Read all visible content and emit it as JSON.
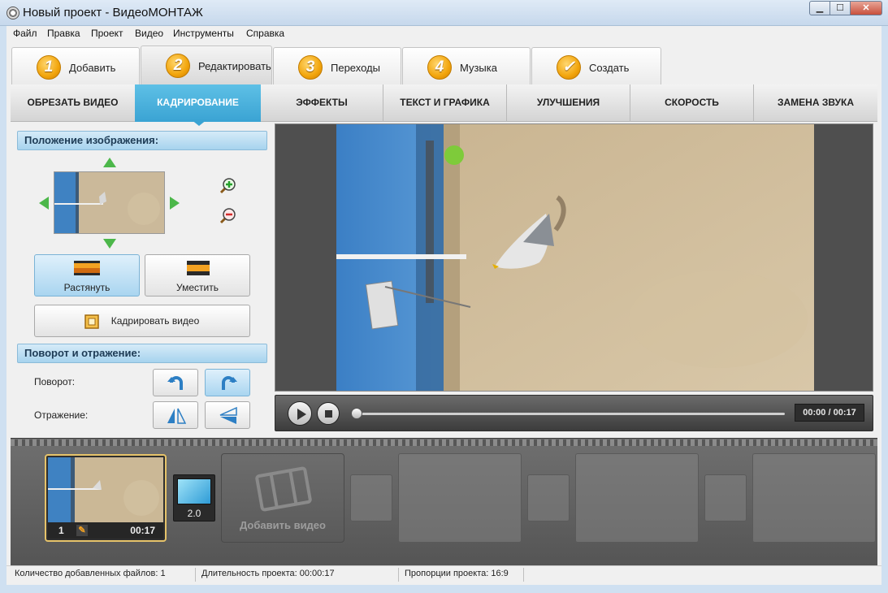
{
  "window": {
    "title": "Новый проект - ВидеоМОНТАЖ"
  },
  "menu": [
    "Файл",
    "Правка",
    "Проект",
    "Видео",
    "Инструменты",
    "Справка"
  ],
  "steps": [
    {
      "num": "1",
      "label": "Добавить"
    },
    {
      "num": "2",
      "label": "Редактировать"
    },
    {
      "num": "3",
      "label": "Переходы"
    },
    {
      "num": "4",
      "label": "Музыка"
    },
    {
      "num": "✓",
      "label": "Создать"
    }
  ],
  "subtabs": [
    "ОБРЕЗАТЬ ВИДЕО",
    "КАДРИРОВАНИЕ",
    "ЭФФЕКТЫ",
    "ТЕКСТ И ГРАФИКА",
    "УЛУЧШЕНИЯ",
    "СКОРОСТЬ",
    "ЗАМЕНА ЗВУКА"
  ],
  "active_subtab": "КАДРИРОВАНИЕ",
  "position": {
    "header": "Положение изображения:",
    "stretch_label": "Растянуть",
    "fit_label": "Уместить",
    "crop_label": "Кадрировать видео"
  },
  "rotation": {
    "header": "Поворот и отражение:",
    "rotate_label": "Поворот:",
    "mirror_label": "Отражение:"
  },
  "player": {
    "time": "00:00 / 00:17",
    "progress": 0
  },
  "timeline": {
    "clip_index": "1",
    "clip_duration": "00:17",
    "transition_duration": "2.0",
    "add_video_label": "Добавить видео"
  },
  "status": {
    "files": "Количество добавленных файлов: 1",
    "duration": "Длительность проекта:  00:00:17",
    "ratio": "Пропорции проекта:  16:9"
  },
  "colors": {
    "accent": "#3aa3d3",
    "step_badge": "#f2a50c",
    "clip_border": "#e6c36a"
  }
}
